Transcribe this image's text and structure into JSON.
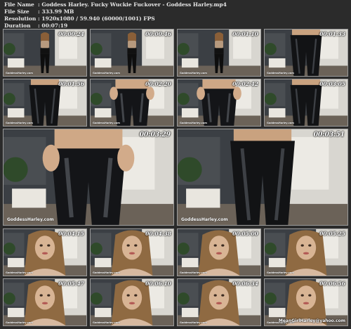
{
  "info": {
    "rows": [
      {
        "key": "File Name",
        "value": ": Goddess Harley. Fucky Wuckie Fuckover - Goddess Harley.mp4"
      },
      {
        "key": "File Size",
        "value": ": 333.99 MB"
      },
      {
        "key": "Resolution",
        "value": ": 1920x1080 / 59.940 (60000/1001) FPS"
      },
      {
        "key": "Duration",
        "value": ": 00:07:19"
      }
    ]
  },
  "thumbnails": [
    {
      "timestamp": "00:00:24",
      "scene": "full-body"
    },
    {
      "timestamp": "00:00:46",
      "scene": "full-body"
    },
    {
      "timestamp": "00:01:10",
      "scene": "full-body"
    },
    {
      "timestamp": "00:01:33",
      "scene": "legs"
    },
    {
      "timestamp": "00:01:56",
      "scene": "legs"
    },
    {
      "timestamp": "00:02:20",
      "scene": "waist"
    },
    {
      "timestamp": "00:02:42",
      "scene": "waist"
    },
    {
      "timestamp": "00:03:05",
      "scene": "legs"
    },
    {
      "timestamp": "00:03:29",
      "scene": "waist"
    },
    {
      "timestamp": "00:03:51",
      "scene": "legs"
    },
    {
      "timestamp": "00:04:15",
      "scene": "face"
    },
    {
      "timestamp": "00:04:38",
      "scene": "face"
    },
    {
      "timestamp": "00:05:00",
      "scene": "face"
    },
    {
      "timestamp": "00:05:25",
      "scene": "face"
    },
    {
      "timestamp": "00:05:47",
      "scene": "face"
    },
    {
      "timestamp": "00:06:10",
      "scene": "face"
    },
    {
      "timestamp": "00:06:34",
      "scene": "face"
    },
    {
      "timestamp": "00:06:56",
      "scene": "face"
    }
  ],
  "watermark": "GoddessHarley.com",
  "corner_watermark": "MeanGirlHarley@yahoo.com",
  "colors": {
    "background": "#2b2b2b",
    "text": "#e8e8e8",
    "border": "#9a9a9a"
  }
}
